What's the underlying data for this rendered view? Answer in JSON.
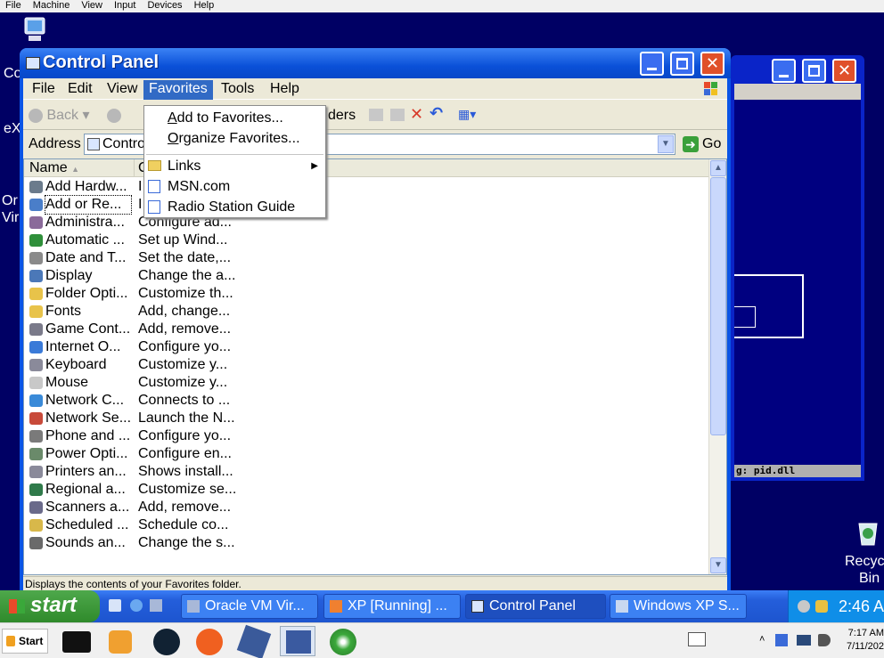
{
  "host_menu": [
    "File",
    "Machine",
    "View",
    "Input",
    "Devices",
    "Help"
  ],
  "desktop_labels": {
    "co": "Co",
    "ex": "eX",
    "or": "Or",
    "vir": "Vir",
    "recycle1": "Recycl",
    "recycle2": "Bin"
  },
  "bg_window": {
    "console_text": "g: pid.dll"
  },
  "window": {
    "title": "Control Panel",
    "menu": [
      "File",
      "Edit",
      "View",
      "Favorites",
      "Tools",
      "Help"
    ],
    "toolbar": {
      "back": "Back",
      "folders": "ders"
    },
    "address": {
      "label": "Address",
      "value": "Contro",
      "go": "Go"
    },
    "columns": {
      "name": "Name",
      "comments": "C"
    },
    "items": [
      {
        "name": "Add Hardw...",
        "comment": "I",
        "icon": "add-hardware-icon",
        "color": "#6b7b8c"
      },
      {
        "name": "Add or Re...",
        "comment": "I",
        "icon": "add-remove-programs-icon",
        "color": "#4a7ec9"
      },
      {
        "name": "Administra...",
        "comment": "Configure ad...",
        "icon": "administrative-tools-icon",
        "color": "#8a6a9a"
      },
      {
        "name": "Automatic ...",
        "comment": "Set up Wind...",
        "icon": "automatic-updates-icon",
        "color": "#2f8f3a"
      },
      {
        "name": "Date and T...",
        "comment": "Set the date,...",
        "icon": "date-time-icon",
        "color": "#8a8a8a"
      },
      {
        "name": "Display",
        "comment": "Change the a...",
        "icon": "display-icon",
        "color": "#4b78b8"
      },
      {
        "name": "Folder Opti...",
        "comment": "Customize th...",
        "icon": "folder-options-icon",
        "color": "#e8c34a"
      },
      {
        "name": "Fonts",
        "comment": "Add, change...",
        "icon": "fonts-folder-icon",
        "color": "#e8c34a"
      },
      {
        "name": "Game Cont...",
        "comment": "Add, remove...",
        "icon": "game-controllers-icon",
        "color": "#7a7a8a"
      },
      {
        "name": "Internet O...",
        "comment": "Configure yo...",
        "icon": "internet-options-icon",
        "color": "#3a7ad8"
      },
      {
        "name": "Keyboard",
        "comment": "Customize y...",
        "icon": "keyboard-icon",
        "color": "#8a8a9a"
      },
      {
        "name": "Mouse",
        "comment": "Customize y...",
        "icon": "mouse-icon",
        "color": "#c8c8c8"
      },
      {
        "name": "Network C...",
        "comment": "Connects to ...",
        "icon": "network-connections-icon",
        "color": "#3a8ad8"
      },
      {
        "name": "Network Se...",
        "comment": "Launch the N...",
        "icon": "network-setup-icon",
        "color": "#c84a3a"
      },
      {
        "name": "Phone and ...",
        "comment": "Configure yo...",
        "icon": "phone-modem-icon",
        "color": "#7a7a7a"
      },
      {
        "name": "Power Opti...",
        "comment": "Configure en...",
        "icon": "power-options-icon",
        "color": "#6a8a6a"
      },
      {
        "name": "Printers an...",
        "comment": "Shows install...",
        "icon": "printers-icon",
        "color": "#8a8a9a"
      },
      {
        "name": "Regional a...",
        "comment": "Customize se...",
        "icon": "regional-options-icon",
        "color": "#2f7a4a"
      },
      {
        "name": "Scanners a...",
        "comment": "Add, remove...",
        "icon": "scanners-cameras-icon",
        "color": "#6a6a8a"
      },
      {
        "name": "Scheduled ...",
        "comment": "Schedule co...",
        "icon": "scheduled-tasks-icon",
        "color": "#d8b84a"
      },
      {
        "name": "Sounds an...",
        "comment": "Change the s...",
        "icon": "sounds-icon",
        "color": "#6a6a6a"
      }
    ],
    "status": "Displays the contents of your Favorites folder."
  },
  "favorites_menu": {
    "add": {
      "u": "A",
      "rest": "dd to Favorites..."
    },
    "organize": {
      "u": "O",
      "rest": "rganize Favorites..."
    },
    "links": "Links",
    "msn": "MSN.com",
    "radio": "Radio Station Guide"
  },
  "taskbar": {
    "start": "start",
    "buttons": [
      "Oracle VM Vir...",
      "XP [Running] ...",
      "Control Panel",
      "Windows XP S..."
    ],
    "clock": "2:46 A"
  },
  "host_taskbar": {
    "start": "Start",
    "time": "7:17 AM",
    "date": "7/11/202"
  }
}
